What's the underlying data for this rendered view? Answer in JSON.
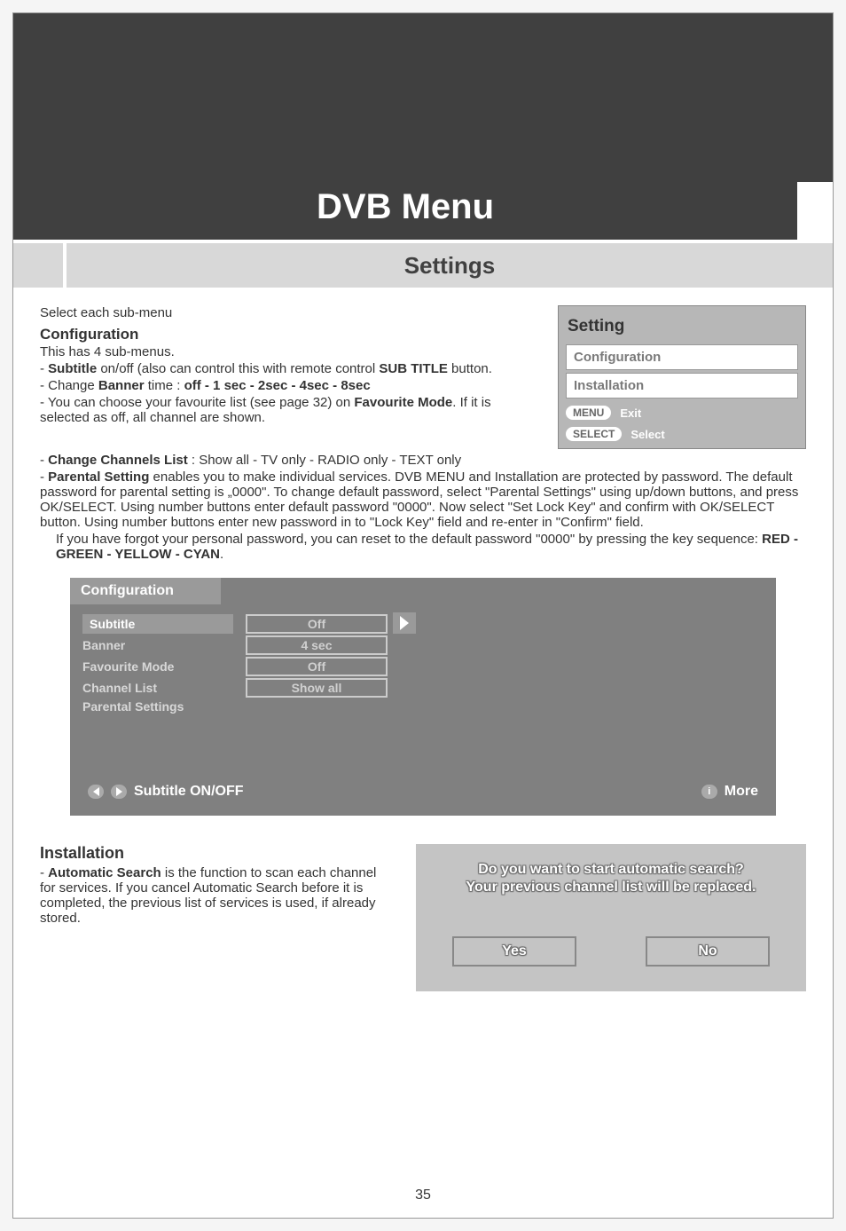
{
  "page_number": "35",
  "header": {
    "title": "DVB Menu",
    "subtitle": "Settings"
  },
  "intro": "Select each sub-menu",
  "config_section": {
    "heading": "Configuration",
    "sub": "This has 4 sub-menus.",
    "b_subtitle_pre": "- ",
    "b_subtitle_bold1": "Subtitle",
    "b_subtitle_mid": " on/off (also can control this with remote control ",
    "b_subtitle_bold2": "SUB TITLE",
    "b_subtitle_end": " button.",
    "b_banner_pre": "- Change ",
    "b_banner_bold1": "Banner",
    "b_banner_mid": " time : ",
    "b_banner_bold2": "off - 1 sec - 2sec - 4sec - 8sec",
    "b_fav_pre": "- You can choose your favourite list (see page 32) on ",
    "b_fav_bold": "Favourite Mode",
    "b_fav_end": ". If it is selected as off, all channel are shown.",
    "b_chlist_pre": "- ",
    "b_chlist_bold": "Change Channels List",
    "b_chlist_end": " : Show all - TV only - RADIO only - TEXT only",
    "b_parental_pre": "- ",
    "b_parental_bold": "Parental Setting",
    "b_parental_end": " enables you to make individual services. DVB MENU and Installation are protected by password. The default password for parental setting is „0000\". To change default password, select \"Parental Settings\" using up/down buttons, and press OK/SELECT. Using number buttons enter default password \"0000\". Now select \"Set Lock Key\" and confirm with OK/SELECT button. Using number buttons enter new password in to \"Lock Key\" field and re-enter in \"Confirm\" field.",
    "reset_note_pre": "If you have forgot your personal password,  you can reset to the default password \"0000\" by pressing the key sequence: ",
    "reset_note_bold": "RED - GREEN - YELLOW - CYAN",
    "reset_note_end": "."
  },
  "side_panel": {
    "title": "Setting",
    "rows": [
      "Configuration",
      "Installation"
    ],
    "menu_pill": "MENU",
    "menu_label": "Exit",
    "select_pill": "SELECT",
    "select_label": "Select"
  },
  "config_screen": {
    "title": "Configuration",
    "rows": [
      {
        "label": "Subtitle",
        "value": "Off",
        "hl": true,
        "arrow": true
      },
      {
        "label": "Banner",
        "value": "4 sec"
      },
      {
        "label": "Favourite Mode",
        "value": "Off"
      },
      {
        "label": "Channel List",
        "value": "Show all"
      },
      {
        "label": "Parental Settings",
        "value": ""
      }
    ],
    "footer_left": "Subtitle ON/OFF",
    "footer_right": "More",
    "i_label": "i"
  },
  "install_section": {
    "heading": "Installation",
    "b_auto_pre": "- ",
    "b_auto_bold": "Automatic Search",
    "b_auto_end": " is the function to scan each channel for services. If you cancel Automatic Search before it is completed, the previous list of services is used, if already stored."
  },
  "dialog": {
    "line1": "Do you want to start automatic search?",
    "line2": "Your previous channel list will be replaced.",
    "yes": "Yes",
    "no": "No"
  }
}
